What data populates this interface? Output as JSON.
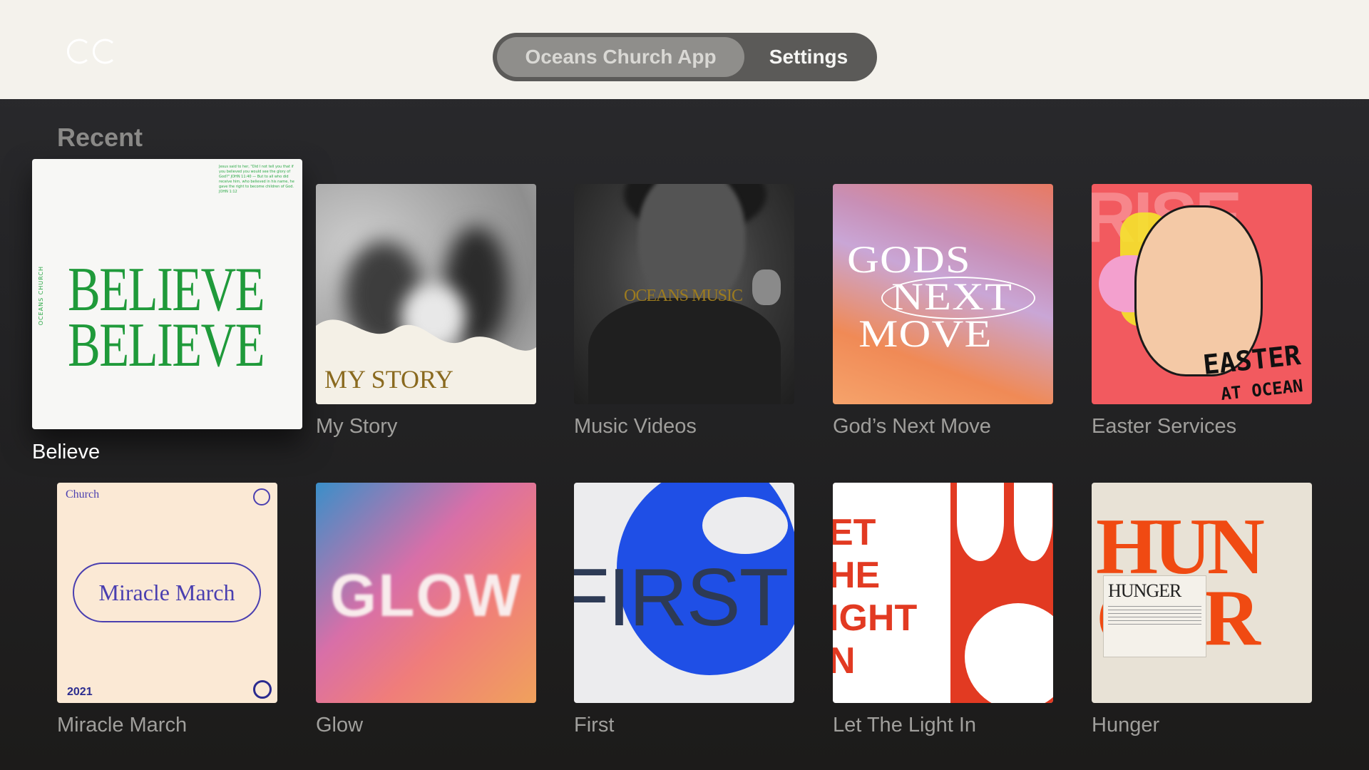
{
  "header": {
    "tabs": [
      {
        "label": "Oceans Church App",
        "active": true
      },
      {
        "label": "Settings",
        "active": false
      }
    ]
  },
  "section": {
    "title": "Recent"
  },
  "items": [
    {
      "title": "Believe",
      "focused": true,
      "art": {
        "main": "BELIEVE\nBELIEVE",
        "side": "OCEANS CHURCH"
      }
    },
    {
      "title": "My Story",
      "art": {
        "main": "MY STORY"
      }
    },
    {
      "title": "Music Videos",
      "art": {
        "main": "OCEANS MUSIC"
      }
    },
    {
      "title": "God’s Next Move",
      "art": {
        "line1": "GODS",
        "line2": "NEXT",
        "line3": "MOVE"
      }
    },
    {
      "title": "Easter Services",
      "art": {
        "main": "EASTER",
        "sub": "AT OCEAN"
      }
    },
    {
      "title": "Miracle March",
      "art": {
        "top": "Church",
        "main": "Miracle March",
        "year": "2021"
      }
    },
    {
      "title": "Glow",
      "art": {
        "main": "GLOW"
      }
    },
    {
      "title": "First",
      "art": {
        "main": "FIRST"
      }
    },
    {
      "title": "Let The Light In",
      "art": {
        "main": "ET\nHE\nIGHT\nN"
      }
    },
    {
      "title": "Hunger",
      "art": {
        "main": "HUN\nGER",
        "card": "HUNGER"
      }
    }
  ],
  "colors": {
    "header_bg": "#f4f2ec",
    "segment_bg": "#5b5a58",
    "segment_active": "#8f8e8b",
    "caption": "#a09f9c",
    "caption_focused": "#ffffff"
  }
}
